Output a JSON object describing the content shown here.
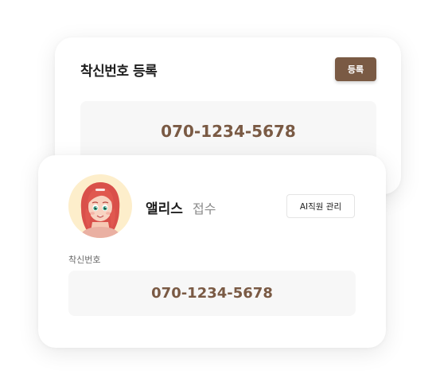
{
  "register_card": {
    "title": "착신번호 등록",
    "register_button": "등록",
    "phone_number": "070-1234-5678"
  },
  "staff_card": {
    "name": "앨리스",
    "role": "접수",
    "manage_button": "AI직원 관리",
    "field_label": "착신번호",
    "phone_number": "070-1234-5678"
  },
  "colors": {
    "accent": "#7a5a44",
    "field_background": "#f7f7f7",
    "avatar_background": "#fdeecb"
  }
}
